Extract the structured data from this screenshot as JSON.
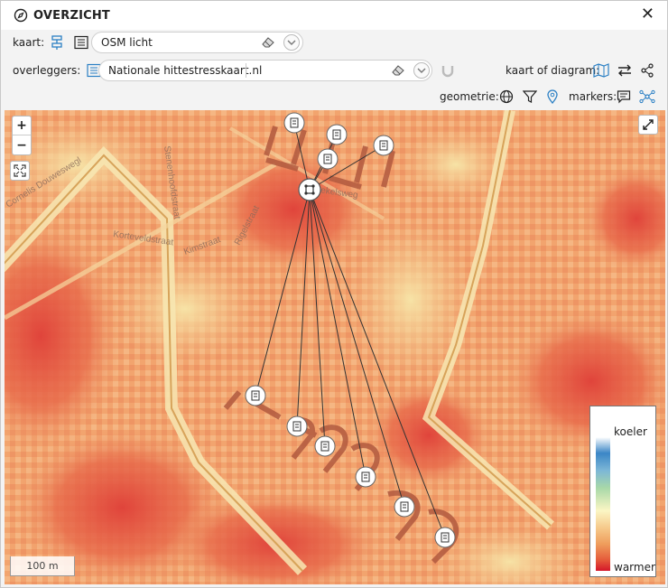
{
  "window": {
    "title": "OVERZICHT",
    "close_symbol": "✕"
  },
  "kaart": {
    "label": "kaart:",
    "value": "OSM licht"
  },
  "overleggers": {
    "label": "overleggers:",
    "value": "Nationale hittestresskaart.nl"
  },
  "kaart_of_diagram": {
    "label": "kaart of diagram:"
  },
  "geometrie": {
    "label": "geometrie:"
  },
  "markers": {
    "label": "markers:"
  },
  "map": {
    "zoom_in": "+",
    "zoom_out": "−",
    "scale_label": "100 m",
    "street_labels": [
      "Cornelis Douweswegl",
      "Korteveldstraat",
      "Stenenhoofdstraat",
      "Kimstraat",
      "Rigelstraat",
      "Krekelsweg"
    ]
  },
  "legend": {
    "top_label": "koeler",
    "bottom_label": "warmer"
  },
  "colors": {
    "accent": "#2a7fc4",
    "marker_fill": "#ffffff",
    "line": "#333333"
  }
}
